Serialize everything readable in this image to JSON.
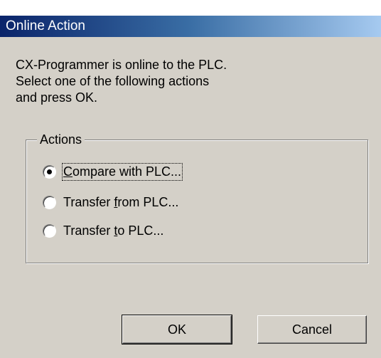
{
  "window": {
    "title": "Online Action"
  },
  "message": {
    "lines": [
      "CX-Programmer is online to the PLC.",
      "Select one of the following actions",
      "and press OK."
    ]
  },
  "actions": {
    "legend": "Actions",
    "options": [
      {
        "pre": "",
        "mnemonic": "C",
        "post": "ompare with PLC...",
        "selected": true
      },
      {
        "pre": "Transfer ",
        "mnemonic": "f",
        "post": "rom PLC...",
        "selected": false
      },
      {
        "pre": "Transfer ",
        "mnemonic": "t",
        "post": "o PLC...",
        "selected": false
      }
    ]
  },
  "buttons": {
    "ok": "OK",
    "cancel": "Cancel"
  },
  "colors": {
    "face": "#d4d0c8",
    "title_start": "#0a246a",
    "title_end": "#a6caf0"
  }
}
